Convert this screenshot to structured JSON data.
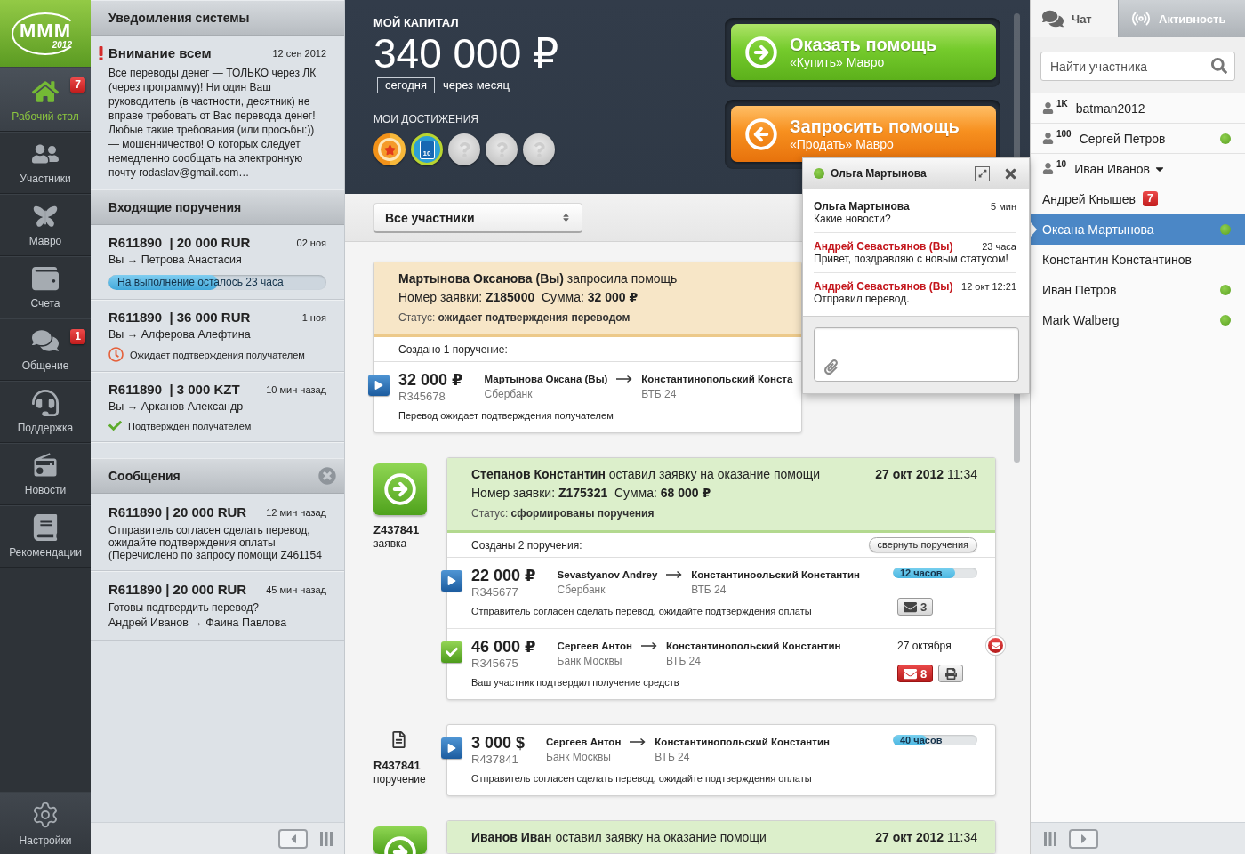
{
  "logo": {
    "text": "МММ",
    "year": "2012"
  },
  "nav": {
    "items": [
      {
        "label": "Рабочий стол",
        "selected": true,
        "badge": "7"
      },
      {
        "label": "Участники",
        "selected": false
      },
      {
        "label": "Мавро",
        "selected": false
      },
      {
        "label": "Счета",
        "selected": false
      },
      {
        "label": "Общение",
        "selected": false,
        "badge": "1"
      },
      {
        "label": "Поддержка",
        "selected": false
      },
      {
        "label": "Новости",
        "selected": false
      },
      {
        "label": "Рекомендации",
        "selected": false
      }
    ],
    "settings": {
      "label": "Настройки"
    }
  },
  "notifications": {
    "title": "Уведомления системы",
    "items": [
      {
        "important": true,
        "title": "Внимание всем",
        "date": "12 сен 2012",
        "text": "Все переводы денег — ТОЛЬКО через ЛК (через программу)! Ни один Ваш руководитель (в частности, десятник) не вправе требовать от Вас перевода денег! Любые такие требования (или просьбы:)) — мошенничество! О которых следует немедленно сообщать на электронную почту rodaslav@gmail.com…"
      }
    ]
  },
  "incoming": {
    "title": "Входящие поручения",
    "items": [
      {
        "heading": "R611890  | 20 000 RUR",
        "date": "02 ноя",
        "route": "Вы → Петрова Анастасия",
        "status": {
          "kind": "progress",
          "text": "На выполнение осталось 23 часа",
          "level": 0.5
        }
      },
      {
        "heading": "R611890  | 36 000 RUR",
        "date": "1 ноя",
        "route": "Вы → Алферова Алефтина",
        "status": {
          "kind": "waiting",
          "text": "Ожидает подтверждения получателем"
        }
      },
      {
        "heading": "R611890  | 3 000 KZT",
        "date": "10 мин назад",
        "route": "Вы → Арканов Александр",
        "status": {
          "kind": "confirmed",
          "text": "Подтвержден получателем"
        }
      }
    ]
  },
  "messages": {
    "title": "Сообщения",
    "items": [
      {
        "heading": "R611890 | 20 000 RUR",
        "time": "12 мин назад",
        "text": "Отправитель согласен сделать перевод, ожидайте подтверждения оплаты (Перечислено по запросу помощи Z461154"
      },
      {
        "heading": "R611890 | 20 000 RUR",
        "time": "45 мин назад",
        "text": "Готовы подтвердить перевод?",
        "route": "Андрей Иванов → Фаина Павлова"
      }
    ]
  },
  "capital": {
    "label": "МОЙ КАПИТАЛ",
    "amount": "340 000 ₽",
    "periods": [
      {
        "label": "сегодня",
        "selected": true
      },
      {
        "label": "через месяц",
        "selected": false
      }
    ],
    "achievements_label": "МОИ ДОСТИЖЕНИЯ",
    "achievements": [
      {
        "earned": true
      },
      {
        "earned": true,
        "label": "10"
      },
      {
        "earned": false
      },
      {
        "earned": false
      },
      {
        "earned": false
      }
    ]
  },
  "actions": [
    {
      "kind": "offer",
      "title": "Оказать помощь",
      "subtitle": "«Купить» Мавро"
    },
    {
      "kind": "request",
      "title": "Запросить помощь",
      "subtitle": "«Продать» Мавро"
    }
  ],
  "filter": {
    "value": "Все участники"
  },
  "feed": [
    {
      "kind": "own_request",
      "title": "**Мартынова Оксанова (Вы)** запросила помощь",
      "details": "Номер заявки: **Z185000**  Сумма: **32 000 ₽**",
      "status": "Статус: **ожидает подтверждения переводом**",
      "orders_label": "Создано 1 поручение:",
      "orders": [
        {
          "confirmed": false,
          "amount": "32 000 ₽",
          "number": "R345678",
          "from": "Мартынова Оксана (Вы)",
          "from_bank": "Сбербанк",
          "to": "Константинопольский Конста",
          "to_bank": "ВТБ 24",
          "note": "Перевод ожидает подтверждения получателем",
          "alert": false,
          "printable": false
        }
      ]
    },
    {
      "kind": "request",
      "code": "Z437841",
      "code_label": "заявка",
      "title": "**Степанов Константин** оставил заявку на оказание помощи",
      "date": "**27 окт 2012** 11:34",
      "details": "Номер заявки: **Z175321**  Сумма: **68 000 ₽**",
      "status": "Статус: **сформированы поручения**",
      "orders_label": "Созданы 2 поручения:",
      "collapse_label": "свернуть поручения",
      "orders": [
        {
          "confirmed": false,
          "amount": "22 000 ₽",
          "number": "R345677",
          "from": "Sevastyanov Andrey",
          "from_bank": "Сбербанк",
          "to": "Константиноольский Константин",
          "to_bank": "ВТБ 24",
          "note": "Отправитель согласен сделать перевод, ожидайте подтверждения оплаты",
          "timer": {
            "text": "12 часов",
            "level": 0.74
          },
          "mail": {
            "count": "3",
            "unread": false
          },
          "alert": false,
          "printable": false
        },
        {
          "confirmed": true,
          "amount": "46 000 ₽",
          "number": "R345675",
          "from": "Сергеев Антон",
          "from_bank": "Банк Москвы",
          "to": "Константинопольский Константин",
          "to_bank": "ВТБ 24",
          "note": "Ваш участник подтвердил получение средств",
          "date": "27 октября",
          "mail": {
            "count": "8",
            "unread": true
          },
          "alert": true,
          "printable": true
        }
      ]
    },
    {
      "kind": "order",
      "code": "R437841",
      "code_label": "поручение",
      "orders": [
        {
          "confirmed": false,
          "amount": "3 000 $",
          "number": "R437841",
          "from": "Сергеев Антон",
          "from_bank": "Банк Москвы",
          "to": "Константинопольский Константин",
          "to_bank": "ВТБ 24",
          "note": "Отправитель согласен сделать перевод, ожидайте подтверждения оплаты",
          "timer": {
            "text": "40 часов",
            "level": 0.4
          },
          "alert": false,
          "printable": false
        }
      ]
    },
    {
      "kind": "request",
      "title": "**Иванов Иван** оставил заявку на оказание помощи",
      "date": "**27 окт 2012** 11:34"
    }
  ],
  "chat": {
    "name": "Ольга Мартынова",
    "online": true,
    "messages": [
      {
        "author": "Ольга Мартынова",
        "time": "5 мин",
        "text": "Какие новости?",
        "mine": false
      },
      {
        "author": "Андрей Севастьянов (Вы)",
        "time": "23 часа",
        "text": "Привет, поздравляю с новым статусом!",
        "mine": true
      },
      {
        "author": "Андрей Севастьянов (Вы)",
        "time": "12 окт 12:21",
        "text": "Отправил перевод.",
        "mine": true
      }
    ]
  },
  "sidebar": {
    "tabs": [
      {
        "label": "Чат",
        "selected": true
      },
      {
        "label": "Активность",
        "selected": false
      }
    ],
    "search": {
      "placeholder": "Найти участника"
    },
    "users": [
      {
        "name": "batman2012",
        "rank": "1K",
        "online": false,
        "selected": false,
        "dropdown": false
      },
      {
        "name": "Сергей Петров",
        "rank": "100",
        "online": true,
        "selected": false,
        "dropdown": false
      },
      {
        "name": "Иван Иванов",
        "rank": "10",
        "online": false,
        "selected": false,
        "dropdown": true
      },
      {
        "name": "Андрей Кнышев",
        "badge": "7",
        "online": false,
        "selected": false,
        "dropdown": false
      },
      {
        "name": "Оксана Мартынова",
        "online": true,
        "selected": true,
        "dropdown": false
      },
      {
        "name": "Константин Константинов",
        "online": false,
        "selected": false,
        "dropdown": false
      },
      {
        "name": "Иван Петров",
        "online": true,
        "selected": false,
        "dropdown": false
      },
      {
        "name": "Mark Walberg",
        "online": true,
        "selected": false,
        "dropdown": false
      }
    ]
  }
}
